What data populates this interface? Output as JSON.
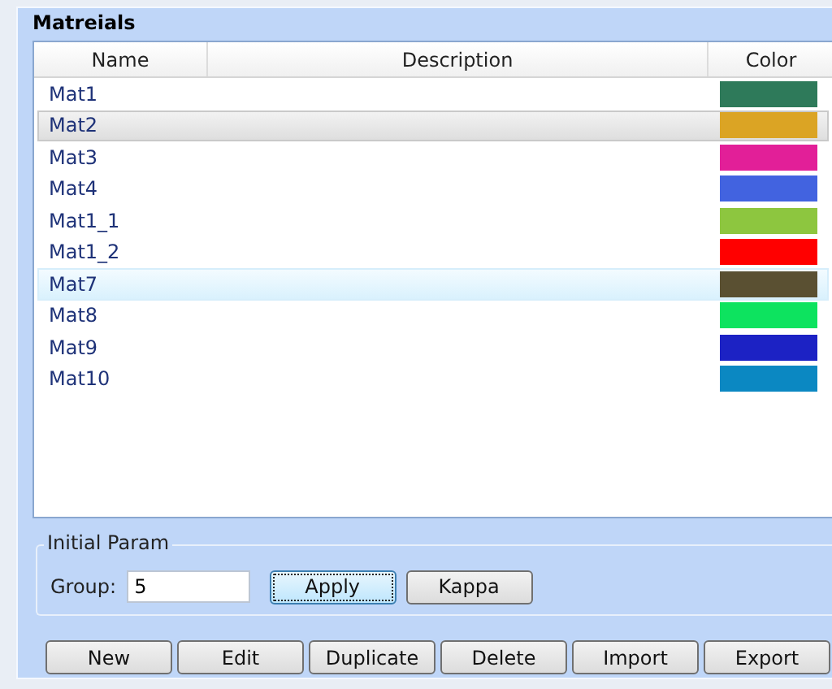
{
  "materials": {
    "title": "Matreials",
    "columns": [
      "Name",
      "Description",
      "Color"
    ],
    "rows": [
      {
        "name": "Mat1",
        "color": "#2e7a5a",
        "selected": false,
        "hovered": false
      },
      {
        "name": "Mat2",
        "color": "#dba424",
        "selected": true,
        "hovered": false
      },
      {
        "name": "Mat3",
        "color": "#e21f98",
        "selected": false,
        "hovered": false
      },
      {
        "name": "Mat4",
        "color": "#4263e0",
        "selected": false,
        "hovered": false
      },
      {
        "name": "Mat1_1",
        "color": "#8dc63f",
        "selected": false,
        "hovered": false
      },
      {
        "name": "Mat1_2",
        "color": "#ff0000",
        "selected": false,
        "hovered": false
      },
      {
        "name": "Mat7",
        "color": "#5a5032",
        "selected": false,
        "hovered": true
      },
      {
        "name": "Mat8",
        "color": "#0de35f",
        "selected": false,
        "hovered": false
      },
      {
        "name": "Mat9",
        "color": "#1c22c4",
        "selected": false,
        "hovered": false
      },
      {
        "name": "Mat10",
        "color": "#0b88c2",
        "selected": false,
        "hovered": false
      }
    ]
  },
  "initial_param": {
    "title": "Initial Param",
    "group_label": "Group:",
    "group_value": "5",
    "buttons": [
      {
        "label": "Apply",
        "focused": true
      },
      {
        "label": "Kappa",
        "focused": false
      }
    ]
  },
  "actions": [
    "New",
    "Edit",
    "Duplicate",
    "Delete",
    "Import",
    "Export"
  ]
}
